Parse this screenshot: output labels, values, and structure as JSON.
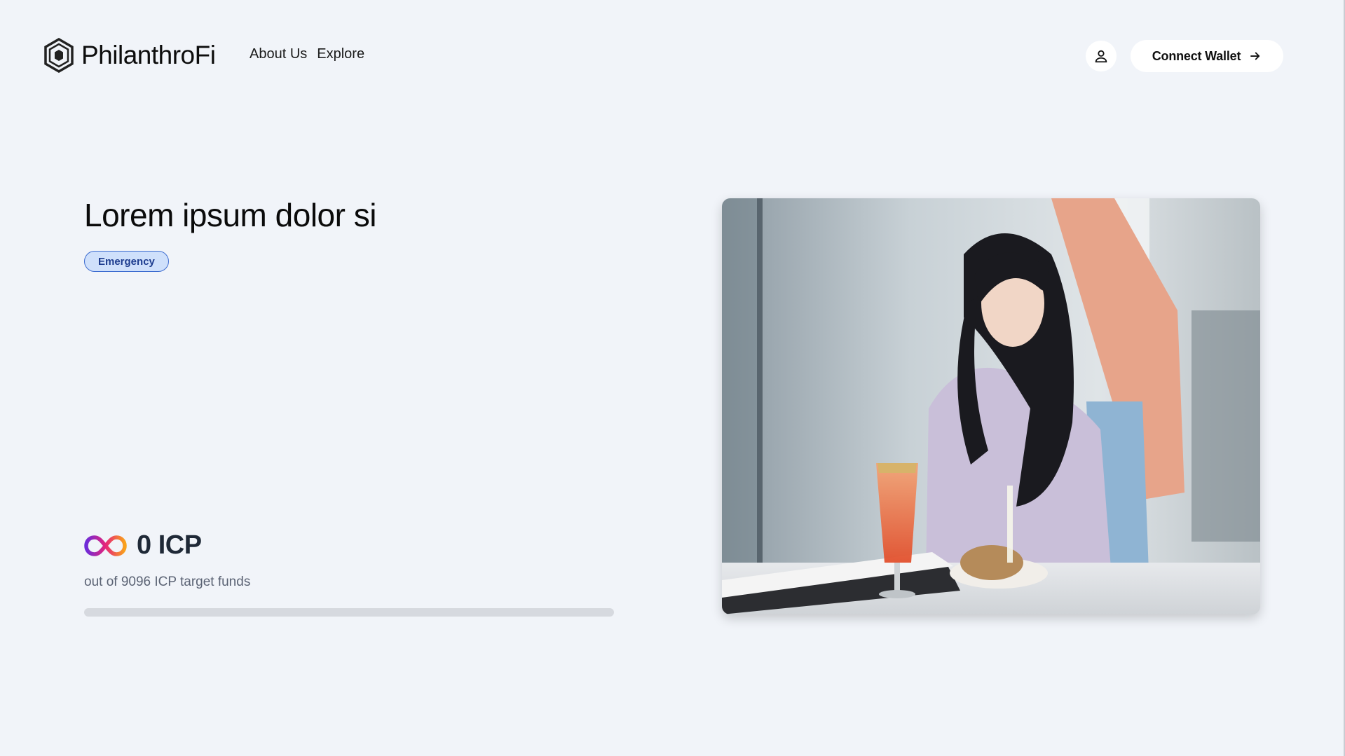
{
  "header": {
    "brand": "PhilanthroFi",
    "nav": [
      "About Us",
      "Explore"
    ],
    "user_icon": "user-icon",
    "connect_label": "Connect Wallet",
    "connect_icon": "arrow-right-icon"
  },
  "campaign": {
    "title": "Lorem ipsum dolor si",
    "category": "Emergency",
    "raised": "0 ICP",
    "target_text": "out of 9096 ICP target funds",
    "progress_percent": 0,
    "currency_icon": "icp-infinity-icon"
  },
  "colors": {
    "background": "#f1f4f9",
    "badge_bg": "#cfe0fb",
    "badge_border": "#3d6cd0",
    "progress_track": "#d6d9df"
  }
}
